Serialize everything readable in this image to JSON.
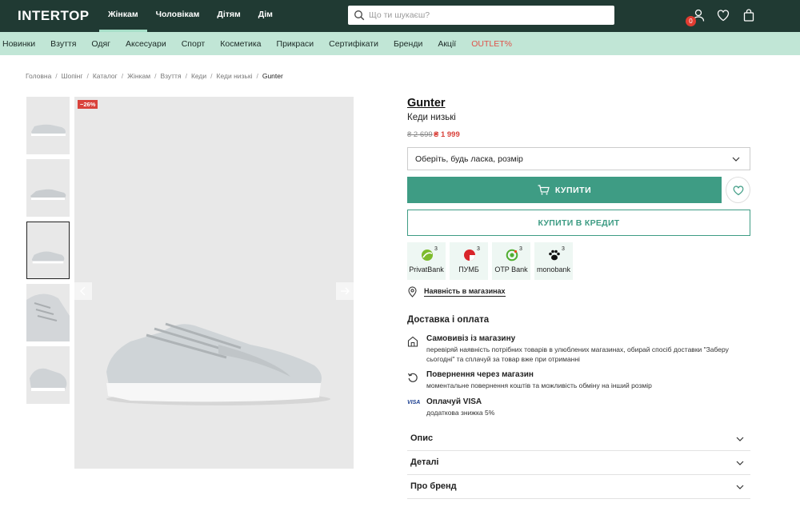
{
  "header": {
    "logo": "INTERTOP",
    "gender_nav": [
      "Жінкам",
      "Чоловікам",
      "Дітям",
      "Дім"
    ],
    "search_placeholder": "Що ти шукаєш?",
    "cart_count": "0"
  },
  "category_nav": [
    "Новинки",
    "Взуття",
    "Одяг",
    "Аксесуари",
    "Спорт",
    "Косметика",
    "Прикраси",
    "Сертифікати",
    "Бренди",
    "Акції",
    "OUTLET%"
  ],
  "breadcrumb": {
    "items": [
      "Головна",
      "Шопінг",
      "Каталог",
      "Жінкам",
      "Взуття",
      "Кеди",
      "Кеди низькі"
    ],
    "current": "Gunter"
  },
  "gallery": {
    "discount": "−26%"
  },
  "product": {
    "brand": "Gunter",
    "type": "Кеди низькі",
    "price_old": "₴ 2 699",
    "price_new": "₴ 1 999",
    "size_placeholder": "Оберіть, будь ласка, розмір",
    "buy_label": "КУПИТИ",
    "credit_label": "КУПИТИ В КРЕДИТ",
    "availability_label": "Наявність в магазинах"
  },
  "banks": [
    {
      "name": "PrivatBank",
      "sup": "3",
      "icon": "privatbank-icon",
      "color": "#7dbb2c"
    },
    {
      "name": "ПУМБ",
      "sup": "3",
      "icon": "pumb-icon",
      "color": "#d9252a"
    },
    {
      "name": "OTP Bank",
      "sup": "3",
      "icon": "otp-icon",
      "color": "#52ae32"
    },
    {
      "name": "monobank",
      "sup": "3",
      "icon": "monobank-icon",
      "color": "#111111"
    }
  ],
  "delivery": {
    "title": "Доставка і оплата",
    "rows": [
      {
        "title": "Самовивіз із магазину",
        "text": "перевіряй наявність потрібних товарів в улюблених магазинах, обирай спосіб доставки \"Заберу сьогодні\" та сплачуй за товар вже при отриманні"
      },
      {
        "title": "Повернення через магазин",
        "text": "моментальне повернення коштів та можливість обміну на інший розмір"
      },
      {
        "title": "Оплачуй VISA",
        "text": "додаткова знижка 5%",
        "mark": "VISA"
      }
    ]
  },
  "accordion": [
    "Опис",
    "Деталі",
    "Про бренд"
  ],
  "colors": {
    "header_bg": "#203a33",
    "category_bg": "#c1e6d6",
    "accent": "#3e9c84",
    "sale": "#d9423b"
  }
}
